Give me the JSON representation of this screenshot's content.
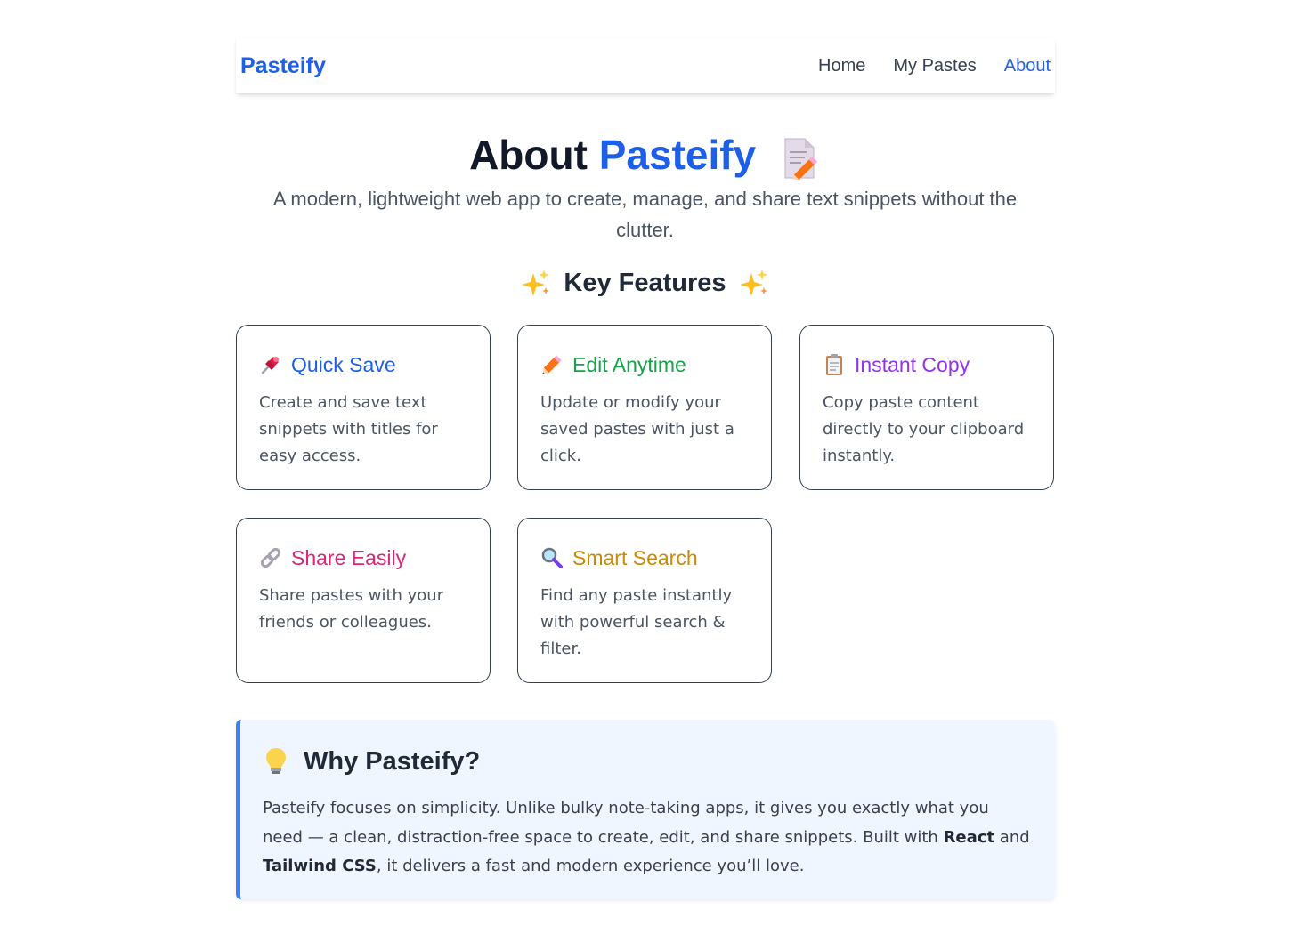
{
  "nav": {
    "brand": "Pasteify",
    "links": [
      {
        "label": "Home",
        "active": false
      },
      {
        "label": "My Pastes",
        "active": false
      },
      {
        "label": "About",
        "active": true
      }
    ]
  },
  "hero": {
    "title_prefix": "About",
    "title_accent": "Pasteify",
    "title_icon": "memo-pencil-icon",
    "subtitle": "A modern, lightweight web app to create, manage, and share text snippets without the clutter."
  },
  "features": {
    "heading": "Key Features",
    "heading_icon": "sparkles-icon",
    "cards": [
      {
        "icon": "pushpin-icon",
        "title": "Quick Save",
        "color": "#1d5fe8",
        "desc": "Create and save text snippets with titles for easy access."
      },
      {
        "icon": "pencil-icon",
        "title": "Edit Anytime",
        "color": "#16a34a",
        "desc": "Update or modify your saved pastes with just a click."
      },
      {
        "icon": "clipboard-icon",
        "title": "Instant Copy",
        "color": "#9333ea",
        "desc": "Copy paste content directly to your clipboard instantly."
      },
      {
        "icon": "link-icon",
        "title": "Share Easily",
        "color": "#db2777",
        "desc": "Share pastes with your friends or colleagues."
      },
      {
        "icon": "magnifier-icon",
        "title": "Smart Search",
        "color": "#ca8a04",
        "desc": "Find any paste instantly with powerful search & filter."
      }
    ]
  },
  "why": {
    "icon": "lightbulb-icon",
    "title": "Why Pasteify?",
    "text_1": "Pasteify focuses on simplicity. Unlike bulky note-taking apps, it gives you exactly what you need — a clean, distraction-free space to create, edit, and share snippets. Built with ",
    "bold_1": "React",
    "text_2": " and ",
    "bold_2": "Tailwind CSS",
    "text_3": ", it delivers a fast and modern experience you’ll love."
  },
  "colors": {
    "brand": "#1d5fe8",
    "why_border": "#3b82f6",
    "why_bg": "#eff6ff"
  }
}
